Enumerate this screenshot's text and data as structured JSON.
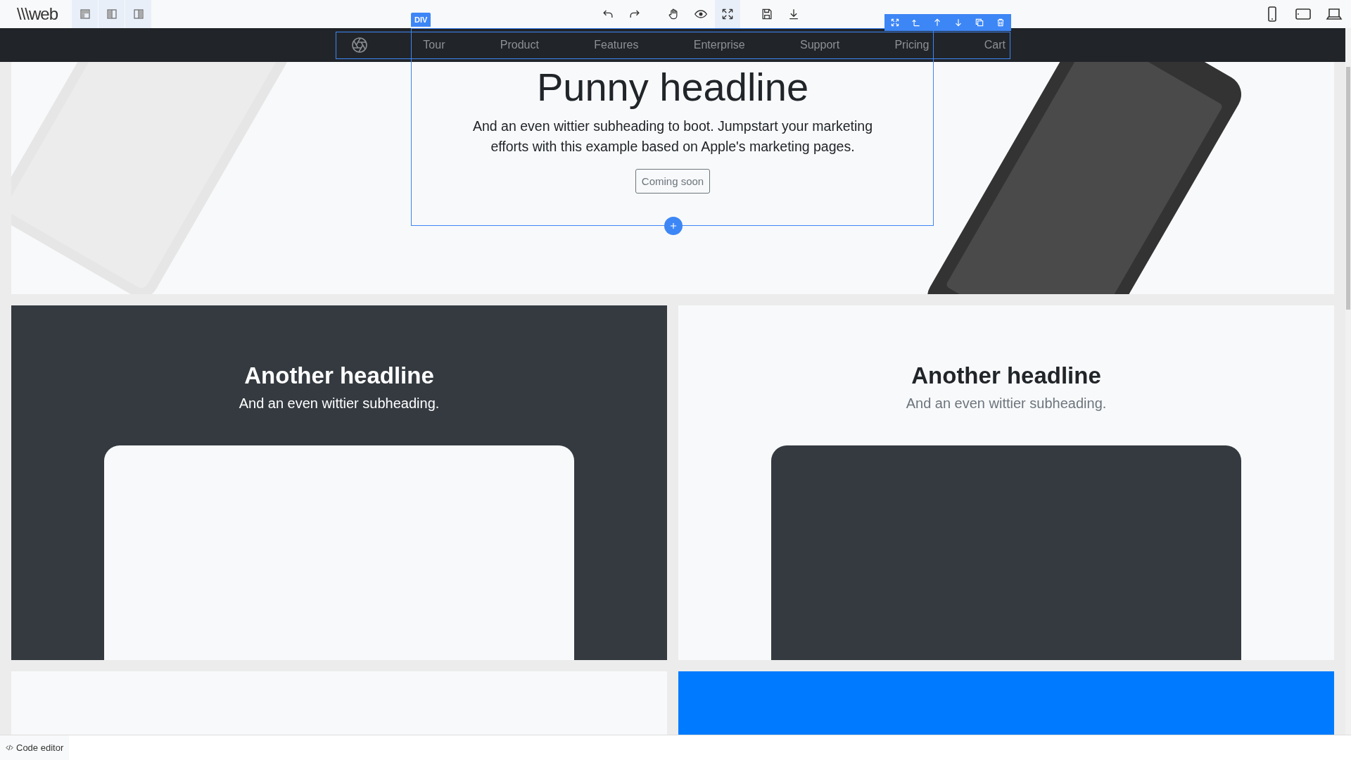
{
  "editor_toolbar": {
    "logo": "\\\\\\web",
    "layout_buttons": [
      {
        "kind": "layout-left",
        "selected": true
      },
      {
        "kind": "layout-split",
        "selected": true
      },
      {
        "kind": "layout-right",
        "selected": true
      }
    ],
    "actions": [
      {
        "kind": "undo",
        "selected": false
      },
      {
        "kind": "redo",
        "selected": false
      },
      {
        "kind": "gap"
      },
      {
        "kind": "hand",
        "selected": false
      },
      {
        "kind": "eye",
        "selected": false
      },
      {
        "kind": "fullscreen",
        "selected": true
      },
      {
        "kind": "gap"
      },
      {
        "kind": "save",
        "selected": false
      },
      {
        "kind": "download",
        "selected": false
      }
    ],
    "devices": [
      {
        "kind": "mobile",
        "selected": false
      },
      {
        "kind": "tablet",
        "selected": false
      },
      {
        "kind": "desktop",
        "selected": false
      }
    ]
  },
  "selection": {
    "tag": "DIV",
    "actions": [
      {
        "kind": "move"
      },
      {
        "kind": "parent"
      },
      {
        "kind": "up"
      },
      {
        "kind": "down"
      },
      {
        "kind": "clone"
      },
      {
        "kind": "delete"
      }
    ]
  },
  "navbar": {
    "items": [
      "Tour",
      "Product",
      "Features",
      "Enterprise",
      "Support",
      "Pricing",
      "Cart"
    ]
  },
  "hero": {
    "headline": "Punny headline",
    "subheading": "And an even wittier subheading to boot. Jumpstart your marketing efforts with this example based on Apple's marketing pages.",
    "button": "Coming soon"
  },
  "cards": [
    {
      "kind": "dark",
      "headline": "Another headline",
      "subheading": "And an even wittier subheading."
    },
    {
      "kind": "light",
      "headline": "Another headline",
      "subheading": "And an even wittier subheading."
    }
  ],
  "lower_cards": [
    {
      "kind": "light"
    },
    {
      "kind": "blue"
    }
  ],
  "code_editor": {
    "label": "Code editor"
  }
}
